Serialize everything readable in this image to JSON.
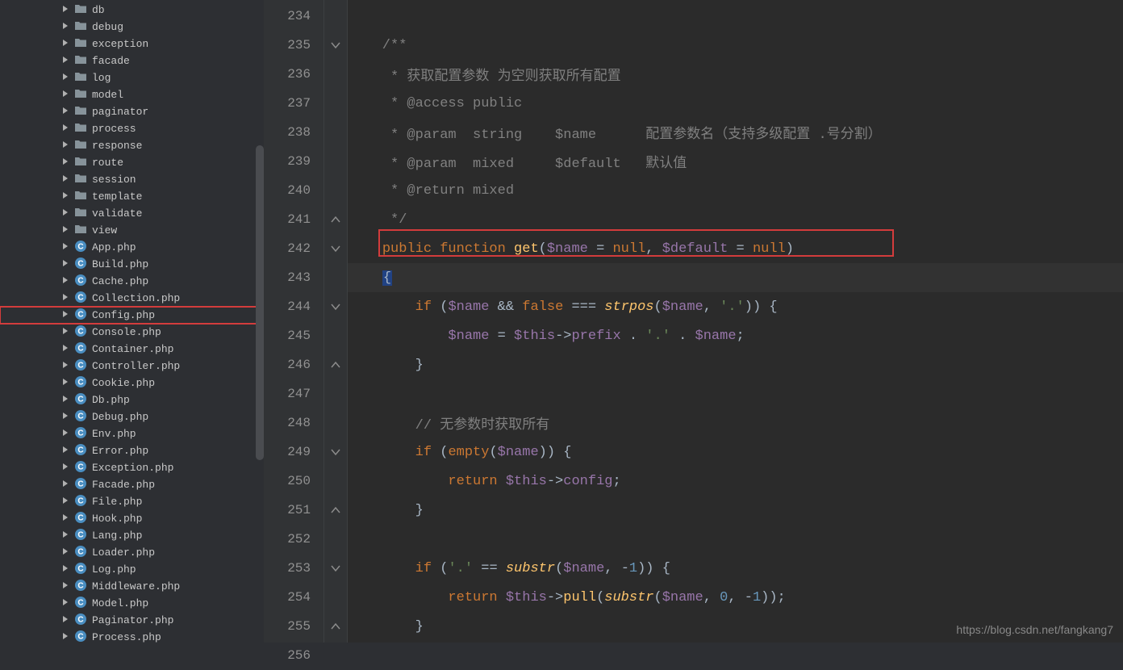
{
  "sidebar": {
    "items": [
      {
        "type": "folder",
        "name": "db"
      },
      {
        "type": "folder",
        "name": "debug"
      },
      {
        "type": "folder",
        "name": "exception"
      },
      {
        "type": "folder",
        "name": "facade"
      },
      {
        "type": "folder",
        "name": "log"
      },
      {
        "type": "folder",
        "name": "model"
      },
      {
        "type": "folder",
        "name": "paginator"
      },
      {
        "type": "folder",
        "name": "process"
      },
      {
        "type": "folder",
        "name": "response"
      },
      {
        "type": "folder",
        "name": "route"
      },
      {
        "type": "folder",
        "name": "session"
      },
      {
        "type": "folder",
        "name": "template"
      },
      {
        "type": "folder",
        "name": "validate"
      },
      {
        "type": "folder",
        "name": "view"
      },
      {
        "type": "class",
        "name": "App.php"
      },
      {
        "type": "class",
        "name": "Build.php"
      },
      {
        "type": "class",
        "name": "Cache.php"
      },
      {
        "type": "class",
        "name": "Collection.php"
      },
      {
        "type": "class",
        "name": "Config.php",
        "highlighted": true
      },
      {
        "type": "class",
        "name": "Console.php"
      },
      {
        "type": "class",
        "name": "Container.php"
      },
      {
        "type": "class",
        "name": "Controller.php"
      },
      {
        "type": "class",
        "name": "Cookie.php"
      },
      {
        "type": "class",
        "name": "Db.php"
      },
      {
        "type": "class",
        "name": "Debug.php"
      },
      {
        "type": "class",
        "name": "Env.php"
      },
      {
        "type": "class",
        "name": "Error.php"
      },
      {
        "type": "class",
        "name": "Exception.php"
      },
      {
        "type": "class",
        "name": "Facade.php"
      },
      {
        "type": "class",
        "name": "File.php"
      },
      {
        "type": "class",
        "name": "Hook.php"
      },
      {
        "type": "class",
        "name": "Lang.php"
      },
      {
        "type": "class",
        "name": "Loader.php"
      },
      {
        "type": "class",
        "name": "Log.php"
      },
      {
        "type": "class",
        "name": "Middleware.php"
      },
      {
        "type": "class",
        "name": "Model.php"
      },
      {
        "type": "class",
        "name": "Paginator.php"
      },
      {
        "type": "class",
        "name": "Process.php"
      }
    ]
  },
  "editor": {
    "lineNumbers": [
      "234",
      "235",
      "236",
      "237",
      "238",
      "239",
      "240",
      "241",
      "242",
      "243",
      "244",
      "245",
      "246",
      "247",
      "248",
      "249",
      "250",
      "251",
      "252",
      "253",
      "254",
      "255",
      "256"
    ],
    "foldMarkers": {
      "235": "open",
      "241": "close",
      "242": "open",
      "244": "open",
      "246": "close",
      "249": "open",
      "251": "close",
      "253": "open",
      "255": "close"
    },
    "lines": {
      "234": [
        {
          "cls": "c-default",
          "t": ""
        }
      ],
      "235": [
        {
          "cls": "c-comment",
          "t": "    /**"
        }
      ],
      "236": [
        {
          "cls": "c-comment",
          "t": "     * 获取配置参数 为空则获取所有配置"
        }
      ],
      "237": [
        {
          "cls": "c-comment",
          "t": "     * @access public"
        }
      ],
      "238": [
        {
          "cls": "c-comment",
          "t": "     * @param  string    $name      配置参数名（支持多级配置 .号分割）"
        }
      ],
      "239": [
        {
          "cls": "c-comment",
          "t": "     * @param  mixed     $default   默认值"
        }
      ],
      "240": [
        {
          "cls": "c-comment",
          "t": "     * @return mixed"
        }
      ],
      "241": [
        {
          "cls": "c-comment",
          "t": "     */"
        }
      ],
      "242": [
        {
          "cls": "c-default",
          "t": "    "
        },
        {
          "cls": "c-keyword",
          "t": "public function "
        },
        {
          "cls": "c-function-decl",
          "t": "get"
        },
        {
          "cls": "c-default",
          "t": "("
        },
        {
          "cls": "c-var",
          "t": "$name"
        },
        {
          "cls": "c-default",
          "t": " = "
        },
        {
          "cls": "c-const",
          "t": "null"
        },
        {
          "cls": "c-default",
          "t": ", "
        },
        {
          "cls": "c-var",
          "t": "$default"
        },
        {
          "cls": "c-default",
          "t": " = "
        },
        {
          "cls": "c-const",
          "t": "null"
        },
        {
          "cls": "c-default",
          "t": ")"
        }
      ],
      "243": [
        {
          "cls": "c-default",
          "t": "    "
        },
        {
          "cls": "c-default cursor-bracket",
          "t": "{"
        }
      ],
      "244": [
        {
          "cls": "c-default",
          "t": "        "
        },
        {
          "cls": "c-keyword",
          "t": "if "
        },
        {
          "cls": "c-default",
          "t": "("
        },
        {
          "cls": "c-var",
          "t": "$name"
        },
        {
          "cls": "c-default",
          "t": " && "
        },
        {
          "cls": "c-const",
          "t": "false"
        },
        {
          "cls": "c-default",
          "t": " === "
        },
        {
          "cls": "c-funcname",
          "t": "strpos"
        },
        {
          "cls": "c-default",
          "t": "("
        },
        {
          "cls": "c-var",
          "t": "$name"
        },
        {
          "cls": "c-default",
          "t": ", "
        },
        {
          "cls": "c-string",
          "t": "'.'"
        },
        {
          "cls": "c-default",
          "t": ")) {"
        }
      ],
      "245": [
        {
          "cls": "c-default",
          "t": "            "
        },
        {
          "cls": "c-var",
          "t": "$name"
        },
        {
          "cls": "c-default",
          "t": " = "
        },
        {
          "cls": "c-var",
          "t": "$this"
        },
        {
          "cls": "c-default",
          "t": "->"
        },
        {
          "cls": "c-field",
          "t": "prefix"
        },
        {
          "cls": "c-default",
          "t": " . "
        },
        {
          "cls": "c-string",
          "t": "'.'"
        },
        {
          "cls": "c-default",
          "t": " . "
        },
        {
          "cls": "c-var",
          "t": "$name"
        },
        {
          "cls": "c-default",
          "t": ";"
        }
      ],
      "246": [
        {
          "cls": "c-default",
          "t": "        }"
        }
      ],
      "247": [
        {
          "cls": "c-default",
          "t": ""
        }
      ],
      "248": [
        {
          "cls": "c-default",
          "t": "        "
        },
        {
          "cls": "c-comment",
          "t": "// 无参数时获取所有"
        }
      ],
      "249": [
        {
          "cls": "c-default",
          "t": "        "
        },
        {
          "cls": "c-keyword",
          "t": "if "
        },
        {
          "cls": "c-default",
          "t": "("
        },
        {
          "cls": "c-keyword",
          "t": "empty"
        },
        {
          "cls": "c-default",
          "t": "("
        },
        {
          "cls": "c-var",
          "t": "$name"
        },
        {
          "cls": "c-default",
          "t": ")) {"
        }
      ],
      "250": [
        {
          "cls": "c-default",
          "t": "            "
        },
        {
          "cls": "c-keyword",
          "t": "return "
        },
        {
          "cls": "c-var",
          "t": "$this"
        },
        {
          "cls": "c-default",
          "t": "->"
        },
        {
          "cls": "c-field",
          "t": "config"
        },
        {
          "cls": "c-default",
          "t": ";"
        }
      ],
      "251": [
        {
          "cls": "c-default",
          "t": "        }"
        }
      ],
      "252": [
        {
          "cls": "c-default",
          "t": ""
        }
      ],
      "253": [
        {
          "cls": "c-default",
          "t": "        "
        },
        {
          "cls": "c-keyword",
          "t": "if "
        },
        {
          "cls": "c-default",
          "t": "("
        },
        {
          "cls": "c-string",
          "t": "'.'"
        },
        {
          "cls": "c-default",
          "t": " == "
        },
        {
          "cls": "c-funcname",
          "t": "substr"
        },
        {
          "cls": "c-default",
          "t": "("
        },
        {
          "cls": "c-var",
          "t": "$name"
        },
        {
          "cls": "c-default",
          "t": ", -"
        },
        {
          "cls": "c-number",
          "t": "1"
        },
        {
          "cls": "c-default",
          "t": ")) {"
        }
      ],
      "254": [
        {
          "cls": "c-default",
          "t": "            "
        },
        {
          "cls": "c-keyword",
          "t": "return "
        },
        {
          "cls": "c-var",
          "t": "$this"
        },
        {
          "cls": "c-default",
          "t": "->"
        },
        {
          "cls": "c-function-decl",
          "t": "pull"
        },
        {
          "cls": "c-default",
          "t": "("
        },
        {
          "cls": "c-funcname",
          "t": "substr"
        },
        {
          "cls": "c-default",
          "t": "("
        },
        {
          "cls": "c-var",
          "t": "$name"
        },
        {
          "cls": "c-default",
          "t": ", "
        },
        {
          "cls": "c-number",
          "t": "0"
        },
        {
          "cls": "c-default",
          "t": ", -"
        },
        {
          "cls": "c-number",
          "t": "1"
        },
        {
          "cls": "c-default",
          "t": "));"
        }
      ],
      "255": [
        {
          "cls": "c-default",
          "t": "        }"
        }
      ],
      "256": [
        {
          "cls": "c-default",
          "t": ""
        }
      ]
    }
  },
  "watermark": "https://blog.csdn.net/fangkang7"
}
